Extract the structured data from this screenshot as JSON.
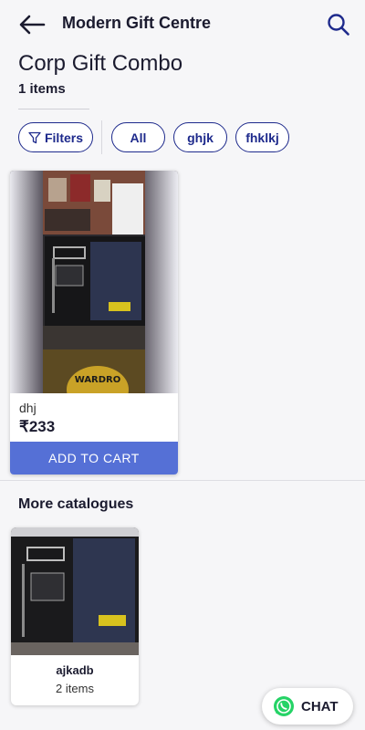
{
  "header": {
    "title": "Modern Gift Centre",
    "back_icon": "back-arrow-icon",
    "search_icon": "search-icon"
  },
  "catalogue": {
    "title": "Corp Gift Combo",
    "count": "1 items"
  },
  "filters": {
    "filter_label": "Filters",
    "chips": [
      "All",
      "ghjk",
      "fhklkj"
    ]
  },
  "products": [
    {
      "name": "dhj",
      "price": "₹233",
      "cta": "ADD TO CART"
    }
  ],
  "more": {
    "title": "More catalogues",
    "items": [
      {
        "name": "ajkadb",
        "count": "2 items"
      }
    ]
  },
  "chat": {
    "label": "CHAT"
  },
  "colors": {
    "accent": "#1e2a8c",
    "button": "#5570d6",
    "whatsapp": "#25d366"
  }
}
